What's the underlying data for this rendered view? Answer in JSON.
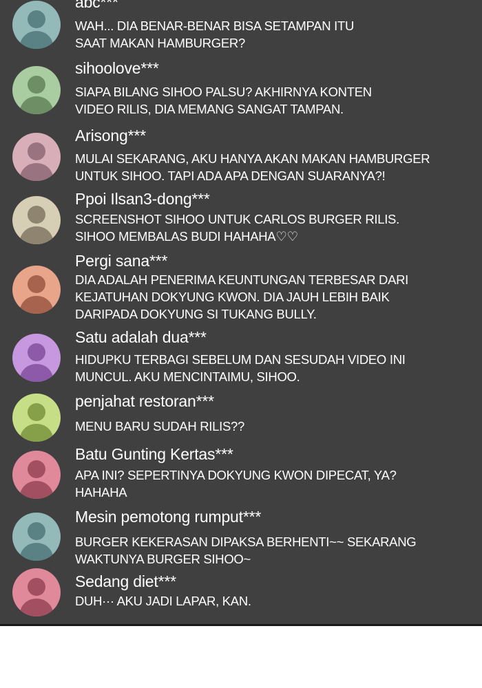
{
  "comments": [
    {
      "username": "abc***",
      "text": "WAH... DIA BENAR-BENAR BISA SETAMPAN ITU\nSAAT MAKAN HAMBURGER?",
      "avatar_color": "#93b9b8",
      "avatar_figure": "#5a8284"
    },
    {
      "username": "sihoolove***",
      "text": "SIAPA BILANG SIHOO PALSU? AKHIRNYA KONTEN\nVIDEO RILIS, DIA MEMANG SANGAT TAMPAN.",
      "avatar_color": "#a9cda0",
      "avatar_figure": "#6e8f66"
    },
    {
      "username": "Arisong***",
      "text": "MULAI SEKARANG, AKU HANYA AKAN MAKAN HAMBURGER\nUNTUK SIHOO. TAPI ADA APA DENGAN SUARANYA?!",
      "avatar_color": "#d8aeb9",
      "avatar_figure": "#9a7380"
    },
    {
      "username": "Ppoi Ilsan3-dong***",
      "text": "SCREENSHOT SIHOO UNTUK CARLOS BURGER RILIS.\nSIHOO MEMBALAS BUDI HAHAHA♡♡",
      "avatar_color": "#d6ceb5",
      "avatar_figure": "#8f8470"
    },
    {
      "username": "Pergi sana***",
      "text": "DIA ADALAH PENERIMA KEUNTUNGAN TERBESAR DARI\nKEJATUHAN DOKYUNG KWON. DIA JAUH LEBIH BAIK\nDARIPADA DOKYUNG SI TUKANG BULLY.",
      "avatar_color": "#e9a58a",
      "avatar_figure": "#a8634f"
    },
    {
      "username": "Satu adalah dua***",
      "text": "HIDUPKU TERBAGI SEBELUM DAN SESUDAH VIDEO INI\nMUNCUL. AKU MENCINTAIMU, SIHOO.",
      "avatar_color": "#c797e0",
      "avatar_figure": "#8c5aa8"
    },
    {
      "username": "penjahat restoran***",
      "text": "MENU BARU SUDAH RILIS??",
      "avatar_color": "#c6de86",
      "avatar_figure": "#86a04a"
    },
    {
      "username": "Batu Gunting Kertas***",
      "text": "APA INI? SEPERTINYA DOKYUNG KWON DIPECAT, YA?\nHAHAHA",
      "avatar_color": "#e0899a",
      "avatar_figure": "#a34f62"
    },
    {
      "username": "Mesin pemotong rumput***",
      "text": "BURGER KEKERASAN DIPAKSA BERHENTI~~ SEKARANG\nWAKTUNYA BURGER SIHOO~",
      "avatar_color": "#93b9b8",
      "avatar_figure": "#5a8284"
    },
    {
      "username": "Sedang diet***",
      "text": "DUH··· AKU JADI LAPAR, KAN.",
      "avatar_color": "#e0899a",
      "avatar_figure": "#a34f62"
    }
  ]
}
